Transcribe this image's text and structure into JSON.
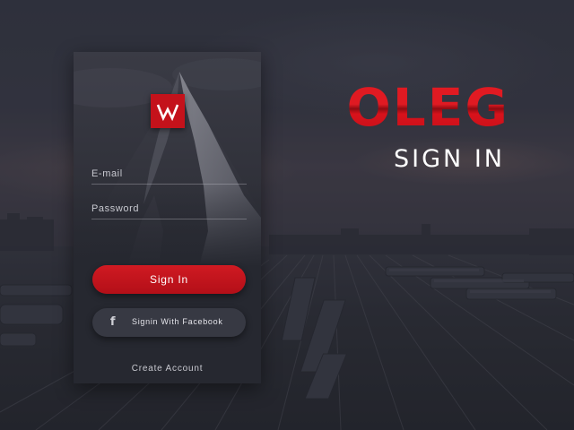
{
  "brand": {
    "title": "OLEG",
    "subtitle": "SIGN IN",
    "accent_color": "#d01a22"
  },
  "login_card": {
    "logo_icon": "w-logo-icon",
    "email_placeholder": "E-mail",
    "password_placeholder": "Password",
    "signin_label": "Sign In",
    "facebook_icon": "facebook-icon",
    "facebook_label": "Signin With Facebook",
    "create_account_label": "Create Account"
  }
}
